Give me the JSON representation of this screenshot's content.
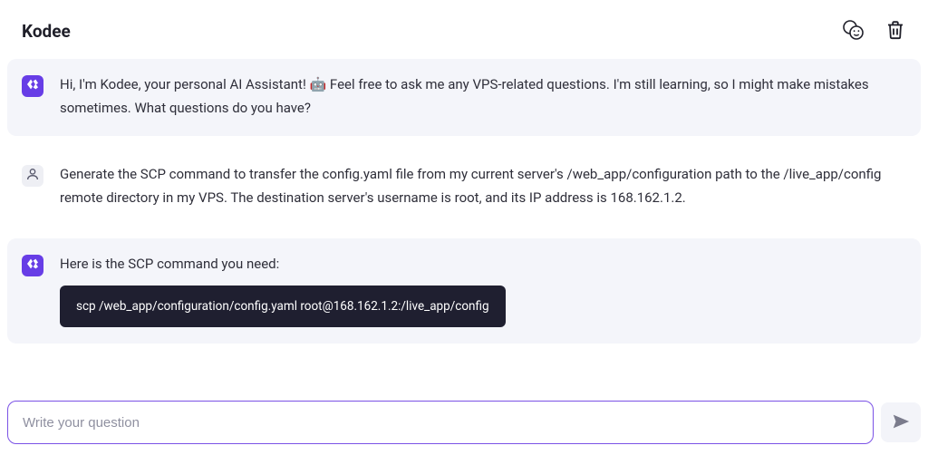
{
  "header": {
    "title": "Kodee"
  },
  "messages": [
    {
      "role": "assistant",
      "text": "Hi, I'm Kodee, your personal AI Assistant! 🤖 Feel free to ask me any VPS-related questions. I'm still learning, so I might make mistakes sometimes. What questions do you have?"
    },
    {
      "role": "user",
      "text": "Generate the SCP command to transfer the config.yaml file from my current server's /web_app/configuration path to the /live_app/config remote directory in my VPS. The destination server's username is root, and its IP address is 168.162.1.2."
    },
    {
      "role": "assistant",
      "text": "Here is the SCP command you need:",
      "code": "scp /web_app/configuration/config.yaml root@168.162.1.2:/live_app/config"
    }
  ],
  "input": {
    "placeholder": "Write your question",
    "value": ""
  }
}
